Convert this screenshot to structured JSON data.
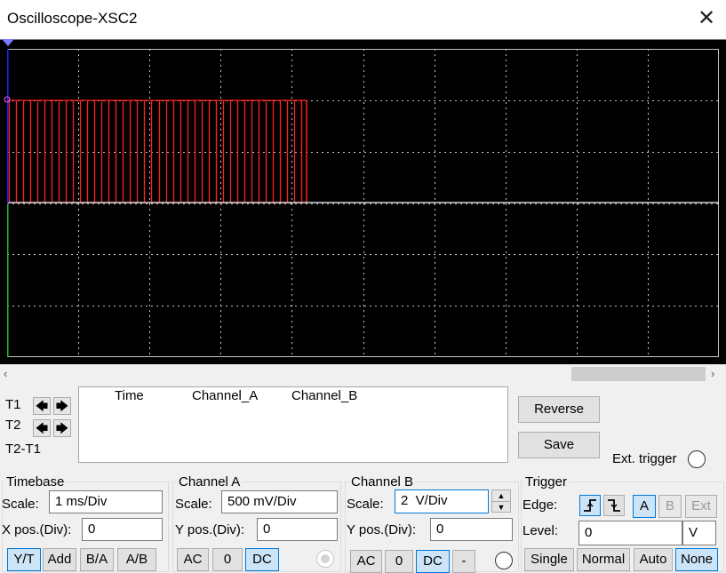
{
  "window": {
    "title": "Oscilloscope-XSC2",
    "close_glyph": "✕"
  },
  "scrollbar": {
    "left_glyph": "‹",
    "right_glyph": "›"
  },
  "cursors": {
    "t1_label": "T1",
    "t2_label": "T2",
    "diff_label": "T2-T1",
    "left_glyph": "🡄",
    "right_glyph": "🡆"
  },
  "readout": {
    "columns": [
      "Time",
      "Channel_A",
      "Channel_B"
    ]
  },
  "actions": {
    "reverse_label": "Reverse",
    "save_label": "Save",
    "ext_trigger_label": "Ext. trigger"
  },
  "timebase": {
    "title": "Timebase",
    "scale_label": "Scale:",
    "scale_value": "1 ms/Div",
    "xpos_label": "X pos.(Div):",
    "xpos_value": "0",
    "modes": [
      "Y/T",
      "Add",
      "B/A",
      "A/B"
    ],
    "selected_mode": "Y/T"
  },
  "channel_a": {
    "title": "Channel A",
    "scale_label": "Scale:",
    "scale_value": "500 mV/Div",
    "ypos_label": "Y pos.(Div):",
    "ypos_value": "0",
    "coupling": [
      "AC",
      "0",
      "DC"
    ],
    "selected_coupling": "DC"
  },
  "channel_b": {
    "title": "Channel B",
    "scale_label": "Scale:",
    "scale_value": "2  V/Div",
    "ypos_label": "Y pos.(Div):",
    "ypos_value": "0",
    "coupling": [
      "AC",
      "0",
      "DC",
      "-"
    ],
    "selected_coupling": "DC"
  },
  "trigger": {
    "title": "Trigger",
    "edge_label": "Edge:",
    "level_label": "Level:",
    "level_value": "0",
    "level_unit": "V",
    "sources": [
      "A",
      "B",
      "Ext"
    ],
    "selected_source": "A",
    "modes": [
      "Single",
      "Normal",
      "Auto",
      "None"
    ],
    "selected_mode": "None"
  },
  "colors": {
    "screen_bg": "#000000",
    "grid": "#c8c8c8",
    "channel_a_trace": "#ff2020",
    "channel_b_trace": "#ffffff",
    "cursor_t1": "#2020ff",
    "cursor_t2": "#20c020"
  }
}
